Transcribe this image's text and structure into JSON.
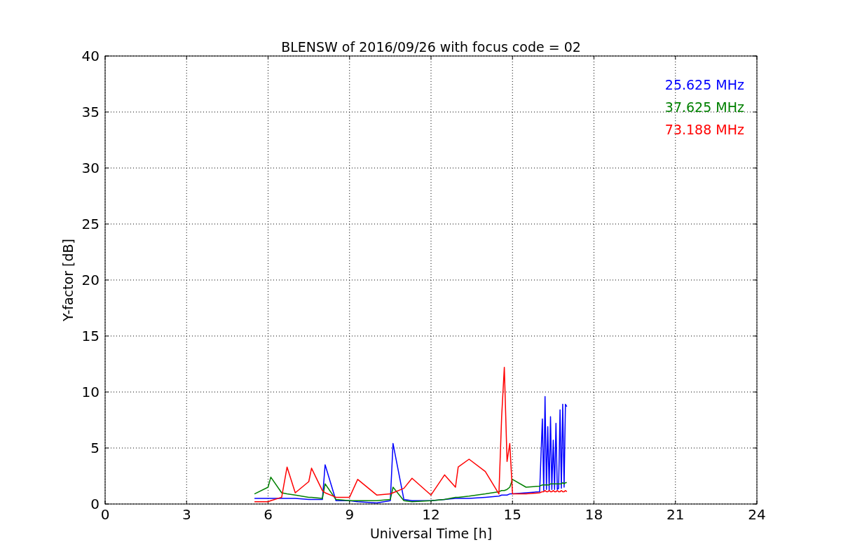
{
  "chart_data": {
    "type": "line",
    "title": "BLENSW of 2016/09/26 with focus code = 02",
    "xlabel": "Universal Time [h]",
    "ylabel": "Y-factor [dB]",
    "x": [
      5.5,
      6,
      6.1,
      6.5,
      6.7,
      7,
      7.5,
      7.6,
      8,
      8.1,
      8.5,
      9,
      9.3,
      10,
      10.5,
      10.6,
      11,
      11.3,
      12,
      12.5,
      12.9,
      13,
      13.4,
      14,
      14.5,
      14.6,
      14.7,
      14.8,
      14.9,
      15,
      15.5,
      16,
      16.1,
      16.15,
      16.2,
      16.25,
      16.3,
      16.35,
      16.4,
      16.45,
      16.5,
      16.55,
      16.6,
      16.65,
      16.7,
      16.75,
      16.8,
      16.85,
      16.9,
      16.95,
      17
    ],
    "series": [
      {
        "name": "25.625 MHz",
        "color": "#0000ff",
        "values": [
          0.5,
          0.5,
          0.5,
          0.5,
          0.5,
          0.5,
          0.4,
          0.4,
          0.4,
          3.5,
          0.3,
          0.3,
          0.2,
          0.1,
          0.3,
          5.4,
          0.4,
          0.3,
          0.3,
          0.4,
          0.5,
          0.5,
          0.5,
          0.6,
          0.7,
          0.8,
          0.8,
          0.8,
          0.9,
          0.9,
          1.0,
          1.1,
          7.6,
          1.2,
          9.6,
          1.3,
          6.9,
          1.2,
          7.8,
          1.3,
          5.7,
          1.3,
          7.2,
          1.3,
          1.4,
          8.4,
          1.4,
          8.9,
          1.5,
          8.9,
          8.7
        ]
      },
      {
        "name": "37.625 MHz",
        "color": "#008000",
        "values": [
          0.9,
          1.5,
          2.4,
          1.0,
          0.9,
          0.8,
          0.6,
          0.6,
          0.5,
          1.8,
          0.4,
          0.3,
          0.3,
          0.3,
          0.4,
          1.5,
          0.3,
          0.2,
          0.3,
          0.4,
          0.6,
          0.6,
          0.7,
          0.9,
          1.1,
          1.2,
          1.2,
          1.3,
          1.5,
          2.2,
          1.5,
          1.6,
          1.7,
          1.7,
          1.7,
          1.7,
          1.7,
          1.7,
          1.8,
          1.8,
          1.8,
          1.8,
          1.8,
          1.8,
          1.8,
          1.8,
          1.8,
          1.9,
          1.8,
          1.9,
          1.9
        ]
      },
      {
        "name": "73.188 MHz",
        "color": "#ff0000",
        "values": [
          0.2,
          0.2,
          0.3,
          0.6,
          3.3,
          1.0,
          2.0,
          3.2,
          1.2,
          1.0,
          0.6,
          0.6,
          2.2,
          0.8,
          0.9,
          1.0,
          1.4,
          2.3,
          0.8,
          2.6,
          1.5,
          3.3,
          4.0,
          2.9,
          0.9,
          7.8,
          12.2,
          3.8,
          5.4,
          0.9,
          0.9,
          1.0,
          1.1,
          1.1,
          1.2,
          1.1,
          1.1,
          1.2,
          1.1,
          1.1,
          1.2,
          1.1,
          1.1,
          1.2,
          1.1,
          1.1,
          1.2,
          1.1,
          1.1,
          1.2,
          1.1
        ]
      }
    ],
    "xlim": [
      0,
      24
    ],
    "ylim": [
      0,
      40
    ],
    "xticks": [
      0,
      3,
      6,
      9,
      12,
      15,
      18,
      21,
      24
    ],
    "yticks": [
      0,
      5,
      10,
      15,
      20,
      25,
      30,
      35,
      40
    ],
    "grid": true
  }
}
